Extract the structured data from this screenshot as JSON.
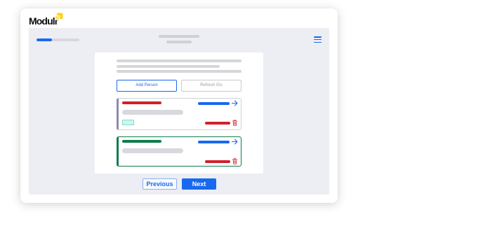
{
  "brand": {
    "name": "Modulr",
    "logo_icon": "modulr-logo-icon"
  },
  "progress": {
    "percent": 36
  },
  "header": {
    "menu_icon": "hamburger-menu-icon"
  },
  "actions": {
    "add_person_label": "Add Person",
    "refresh_ids_label": "Refresh IDs"
  },
  "person_cards": [
    {
      "accent_color": "#8e8aa9",
      "border_color": "#cfd1d6",
      "name_bar_color": "#d21f2c",
      "open_icon": "arrow-right-icon",
      "delete_icon": "trash-icon"
    },
    {
      "accent_color": "#0e7c4d",
      "border_color": "#0e7c4d",
      "name_bar_color": "#0e7c4d",
      "open_icon": "arrow-right-icon",
      "delete_icon": "trash-icon"
    }
  ],
  "navigation": {
    "previous_label": "Previous",
    "next_label": "Next"
  },
  "colors": {
    "primary": "#1769f0",
    "danger": "#d21f2c",
    "success": "#0e7c4d",
    "brand-yellow": "#ffd21f",
    "tag-fill": "#cdf6f0",
    "tag-border": "#82dccf"
  }
}
